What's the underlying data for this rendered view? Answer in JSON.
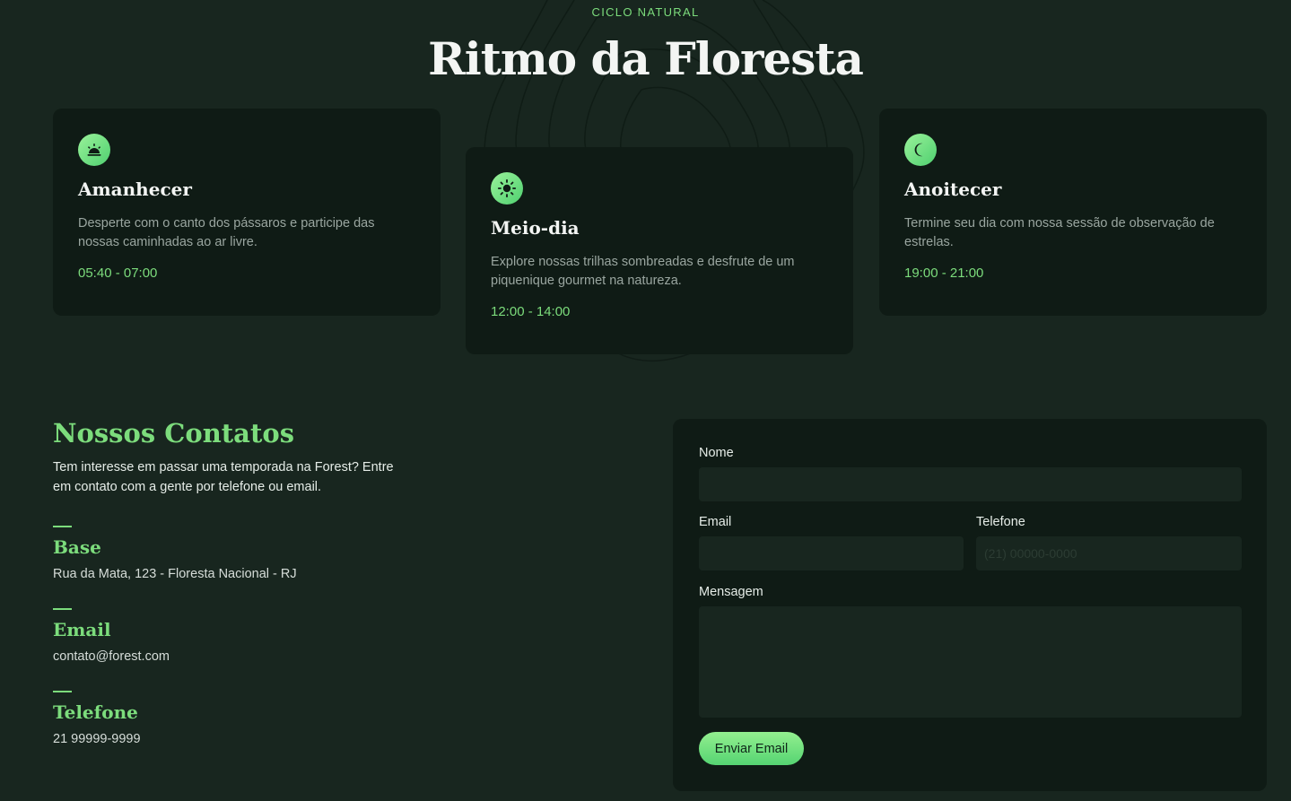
{
  "header": {
    "eyebrow": "CICLO NATURAL",
    "title": "Ritmo da Floresta"
  },
  "cards": [
    {
      "icon": "sunrise-icon",
      "title": "Amanhecer",
      "description": "Desperte com o canto dos pássaros e participe das nossas caminhadas ao ar livre.",
      "time": "05:40 - 07:00"
    },
    {
      "icon": "sun-icon",
      "title": "Meio-dia",
      "description": "Explore nossas trilhas sombreadas e desfrute de um piquenique gourmet na natureza.",
      "time": "12:00 - 14:00"
    },
    {
      "icon": "moon-icon",
      "title": "Anoitecer",
      "description": "Termine seu dia com nossa sessão de observação de estrelas.",
      "time": "19:00 - 21:00"
    }
  ],
  "contacts": {
    "title": "Nossos Contatos",
    "intro": "Tem interesse em passar uma temporada na Forest? Entre em contato com a gente por telefone ou email.",
    "items": [
      {
        "label": "Base",
        "value": "Rua da Mata, 123 - Floresta Nacional - RJ"
      },
      {
        "label": "Email",
        "value": "contato@forest.com"
      },
      {
        "label": "Telefone",
        "value": "21 99999-9999"
      }
    ]
  },
  "form": {
    "name_label": "Nome",
    "name_value": "",
    "email_label": "Email",
    "email_value": "",
    "phone_label": "Telefone",
    "phone_placeholder": "(21) 00000-0000",
    "message_label": "Mensagem",
    "message_value": "",
    "submit_label": "Enviar Email"
  },
  "colors": {
    "background": "#18261f",
    "card": "#0f1b15",
    "accent": "#7cdc7c"
  }
}
